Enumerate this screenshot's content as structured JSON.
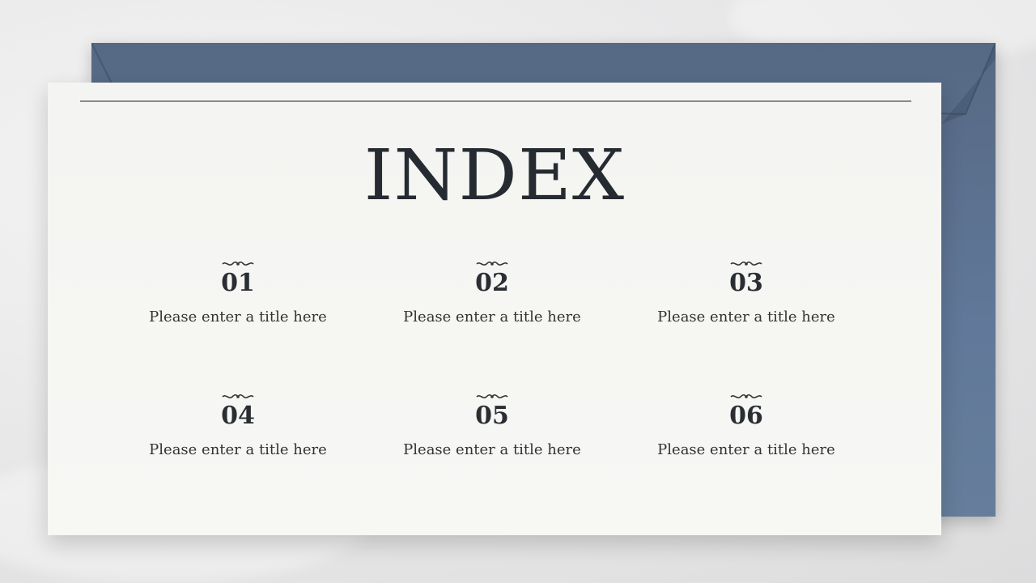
{
  "slide": {
    "title": "INDEX",
    "colors": {
      "envelope": "#61789a",
      "card": "#f5f5f3",
      "text": "#262b31"
    },
    "items": [
      {
        "number": "01",
        "label": "Please enter a title here",
        "icon": "ornament-flourish-icon"
      },
      {
        "number": "02",
        "label": "Please enter a title here",
        "icon": "ornament-flourish-icon"
      },
      {
        "number": "03",
        "label": "Please enter a title here",
        "icon": "ornament-flourish-icon"
      },
      {
        "number": "04",
        "label": "Please enter a title here",
        "icon": "ornament-flourish-icon"
      },
      {
        "number": "05",
        "label": "Please enter a title here",
        "icon": "ornament-flourish-icon"
      },
      {
        "number": "06",
        "label": "Please enter a title here",
        "icon": "ornament-flourish-icon"
      }
    ]
  }
}
